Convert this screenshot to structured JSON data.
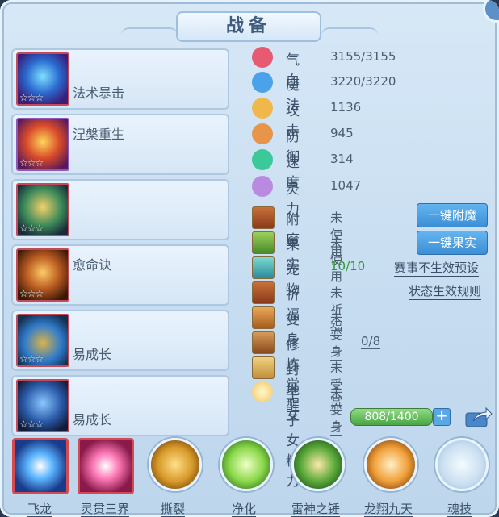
{
  "title": "战备",
  "skills": [
    {
      "name": "法术暴击",
      "stars": "☆☆☆"
    },
    {
      "name": "涅槃重生",
      "stars": "☆☆☆"
    },
    {
      "name": "",
      "stars": "☆☆☆"
    },
    {
      "name": "愈命诀",
      "stars": "☆☆☆"
    },
    {
      "name": "易成长",
      "stars": "☆☆☆"
    },
    {
      "name": "易成长",
      "stars": "☆☆☆"
    }
  ],
  "stats": {
    "hp": {
      "label": "气血",
      "value": "3155/3155"
    },
    "mp": {
      "label": "魔法",
      "value": "3220/3220"
    },
    "atk": {
      "label": "攻击",
      "value": "1136"
    },
    "def": {
      "label": "防御",
      "value": "945"
    },
    "spd": {
      "label": "速度",
      "value": "314"
    },
    "spi": {
      "label": "灵力",
      "value": "1047"
    }
  },
  "items": {
    "enchant": {
      "label": "附魔",
      "value": "未使用"
    },
    "fruit": {
      "label": "果实",
      "value": "未使用"
    },
    "pet": {
      "label": "宠物",
      "value": "10/10"
    },
    "pray": {
      "label": "祈福",
      "value": "未祈福"
    },
    "transform": {
      "label": "变身",
      "value": "未变身"
    },
    "awaken": {
      "label": "修炼觉醒",
      "value": "0/8"
    },
    "fief": {
      "label": "封地",
      "value": "未受赏"
    },
    "child": {
      "label": "子女",
      "value": "未变身"
    },
    "energy": {
      "label": "子女精力",
      "value": "808/1400",
      "fraction": 0.577
    }
  },
  "buttons": {
    "enchant_all": "一键附魔",
    "fruit_all": "一键果实",
    "event_preset": "赛事不生效预设",
    "status_rules": "状态生效规则",
    "plus": "+"
  },
  "bottom_skills": [
    "飞龙",
    "灵贯三界",
    "撕裂",
    "净化",
    "雷神之锤",
    "龙翔九天",
    "魂技"
  ],
  "colors": {
    "accent_blue": "#3d8fd6",
    "pet_green": "#2c9a2c",
    "frame_red": "#c44a58"
  }
}
